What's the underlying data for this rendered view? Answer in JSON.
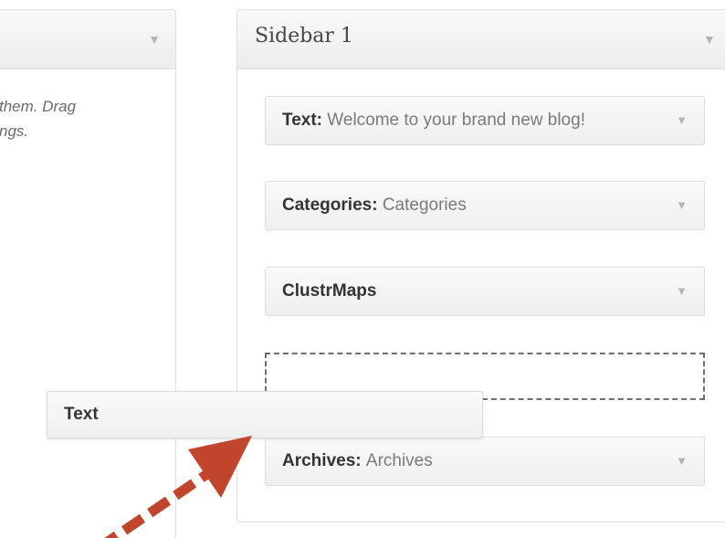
{
  "available": {
    "description_lines": [
      "them. Drag",
      "ngs."
    ]
  },
  "sidebar": {
    "title": "Sidebar 1",
    "widgets": [
      {
        "name": "Text",
        "separator": ": ",
        "subtitle": "Welcome to your brand new blog!"
      },
      {
        "name": "Categories",
        "separator": ": ",
        "subtitle": "Categories"
      },
      {
        "name": "ClustrMaps",
        "separator": "",
        "subtitle": ""
      },
      {
        "name": "Archives",
        "separator": ": ",
        "subtitle": "Archives"
      }
    ]
  },
  "dragging": {
    "label": "Text"
  },
  "icons": {
    "toggle": "triangle-down-icon"
  },
  "colors": {
    "arrow": "#c0452c"
  }
}
